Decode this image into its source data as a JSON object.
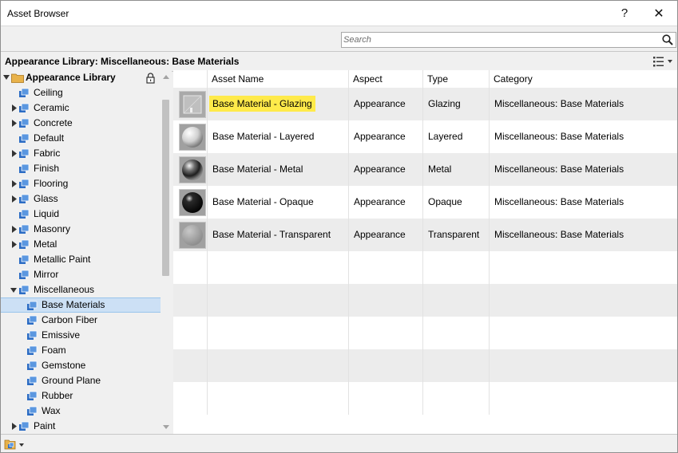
{
  "window": {
    "title": "Asset Browser",
    "help_label": "?",
    "close_label": "✕"
  },
  "search": {
    "placeholder": "Search",
    "value": ""
  },
  "path": {
    "text": "Appearance Library: Miscellaneous: Base Materials"
  },
  "tree": {
    "root_label": "Appearance Library",
    "items": [
      {
        "label": "Ceiling",
        "expandable": false,
        "level": 1
      },
      {
        "label": "Ceramic",
        "expandable": true,
        "level": 1
      },
      {
        "label": "Concrete",
        "expandable": true,
        "level": 1
      },
      {
        "label": "Default",
        "expandable": false,
        "level": 1
      },
      {
        "label": "Fabric",
        "expandable": true,
        "level": 1
      },
      {
        "label": "Finish",
        "expandable": false,
        "level": 1
      },
      {
        "label": "Flooring",
        "expandable": true,
        "level": 1
      },
      {
        "label": "Glass",
        "expandable": true,
        "level": 1
      },
      {
        "label": "Liquid",
        "expandable": false,
        "level": 1
      },
      {
        "label": "Masonry",
        "expandable": true,
        "level": 1
      },
      {
        "label": "Metal",
        "expandable": true,
        "level": 1
      },
      {
        "label": "Metallic Paint",
        "expandable": false,
        "level": 1
      },
      {
        "label": "Mirror",
        "expandable": false,
        "level": 1
      },
      {
        "label": "Miscellaneous",
        "expandable": true,
        "expanded": true,
        "level": 1
      },
      {
        "label": "Base Materials",
        "expandable": false,
        "level": 2,
        "selected": true
      },
      {
        "label": "Carbon Fiber",
        "expandable": false,
        "level": 2
      },
      {
        "label": "Emissive",
        "expandable": false,
        "level": 2
      },
      {
        "label": "Foam",
        "expandable": false,
        "level": 2
      },
      {
        "label": "Gemstone",
        "expandable": false,
        "level": 2
      },
      {
        "label": "Ground Plane",
        "expandable": false,
        "level": 2
      },
      {
        "label": "Rubber",
        "expandable": false,
        "level": 2
      },
      {
        "label": "Wax",
        "expandable": false,
        "level": 2
      },
      {
        "label": "Paint",
        "expandable": true,
        "level": 1
      }
    ]
  },
  "table": {
    "columns": [
      "",
      "Asset Name",
      "Aspect",
      "Type",
      "Category"
    ],
    "rows": [
      {
        "name": "Base Material - Glazing",
        "aspect": "Appearance",
        "type": "Glazing",
        "category": "Miscellaneous: Base Materials",
        "thumb": "glazing",
        "highlighted": true
      },
      {
        "name": "Base Material - Layered",
        "aspect": "Appearance",
        "type": "Layered",
        "category": "Miscellaneous: Base Materials",
        "thumb": "layered",
        "highlighted": false
      },
      {
        "name": "Base Material - Metal",
        "aspect": "Appearance",
        "type": "Metal",
        "category": "Miscellaneous: Base Materials",
        "thumb": "metal",
        "highlighted": false
      },
      {
        "name": "Base Material - Opaque",
        "aspect": "Appearance",
        "type": "Opaque",
        "category": "Miscellaneous: Base Materials",
        "thumb": "opaque",
        "highlighted": false
      },
      {
        "name": "Base Material - Transparent",
        "aspect": "Appearance",
        "type": "Transparent",
        "category": "Miscellaneous: Base Materials",
        "thumb": "transparent",
        "highlighted": false
      }
    ],
    "empty_rows": 5
  },
  "colors": {
    "selection": "#cce0f5",
    "highlight": "#ffea4a",
    "folder": "#e8b24a",
    "library_icon": "#2b6cc4"
  }
}
